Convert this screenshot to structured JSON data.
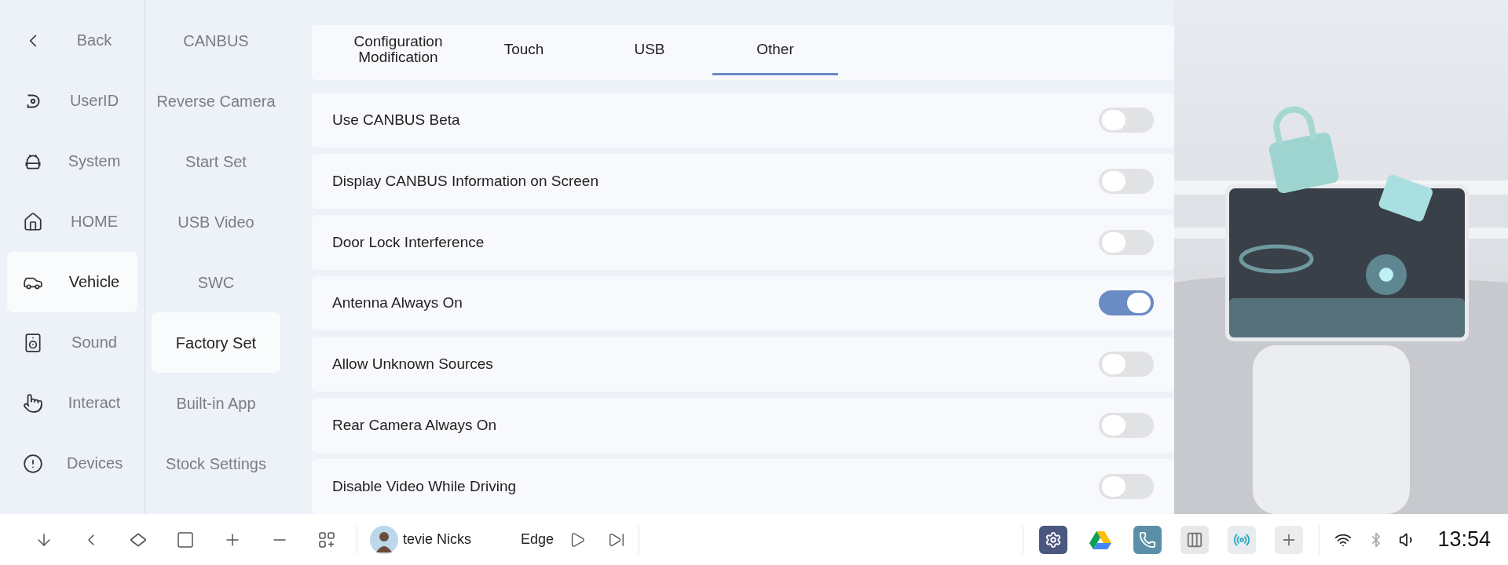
{
  "nav": [
    {
      "label": "Back",
      "selected": false
    },
    {
      "label": "UserID",
      "selected": false
    },
    {
      "label": "System",
      "selected": false
    },
    {
      "label": "HOME",
      "selected": false
    },
    {
      "label": "Vehicle",
      "selected": true
    },
    {
      "label": "Sound",
      "selected": false
    },
    {
      "label": "Interact",
      "selected": false
    },
    {
      "label": "Devices",
      "selected": false
    }
  ],
  "submenu": [
    {
      "label": "CANBUS",
      "selected": false
    },
    {
      "label": "Reverse Camera",
      "selected": false
    },
    {
      "label": "Start Set",
      "selected": false
    },
    {
      "label": "USB Video",
      "selected": false
    },
    {
      "label": "SWC",
      "selected": false
    },
    {
      "label": "Factory Set",
      "selected": true
    },
    {
      "label": "Built-in App",
      "selected": false
    },
    {
      "label": "Stock Settings",
      "selected": false
    }
  ],
  "tabs": [
    {
      "label": "Configuration Modification",
      "selected": false
    },
    {
      "label": "Touch",
      "selected": false
    },
    {
      "label": "USB",
      "selected": false
    },
    {
      "label": "Other",
      "selected": true
    }
  ],
  "settings": [
    {
      "label": "Use CANBUS Beta",
      "on": false
    },
    {
      "label": "Display CANBUS Information on Screen",
      "on": false
    },
    {
      "label": "Door Lock Interference",
      "on": false
    },
    {
      "label": "Antenna Always On",
      "on": true
    },
    {
      "label": "Allow Unknown Sources",
      "on": false
    },
    {
      "label": "Rear Camera Always On",
      "on": false
    },
    {
      "label": "Disable Video While Driving",
      "on": false
    }
  ],
  "taskbar": {
    "media": {
      "artist": "tevie Nicks",
      "title": "Edge"
    },
    "time": "13:54"
  }
}
